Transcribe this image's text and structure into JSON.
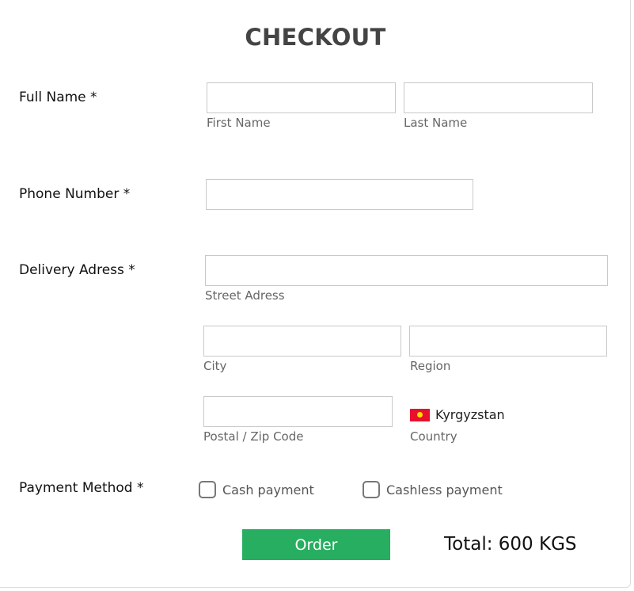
{
  "form": {
    "title": "CHECKOUT",
    "full_name": {
      "label": "Full Name *",
      "first_value": "",
      "first_sublabel": "First Name",
      "last_value": "",
      "last_sublabel": "Last Name"
    },
    "phone": {
      "label": "Phone Number *",
      "value": ""
    },
    "address": {
      "label": "Delivery Adress *",
      "street_value": "",
      "street_sublabel": "Street Adress",
      "city_value": "",
      "city_sublabel": "City",
      "region_value": "",
      "region_sublabel": "Region",
      "postal_value": "",
      "postal_sublabel": "Postal / Zip Code",
      "country_value": "Kyrgyzstan",
      "country_sublabel": "Country",
      "country_flag_icon": "kyrgyzstan-flag-icon",
      "flag_colors": {
        "field": "#e8112d",
        "sun": "#ffdf00"
      }
    },
    "payment": {
      "label": "Payment Method *",
      "options": [
        {
          "label": "Cash payment",
          "checked": false
        },
        {
          "label": "Cashless payment",
          "checked": false
        }
      ]
    },
    "order_button_label": "Order",
    "total_text": "Total: 600 KGS"
  },
  "colors": {
    "accent": "#27ae60",
    "title": "#444444",
    "sublabel": "#666666",
    "input_border": "#c9c9c9"
  }
}
